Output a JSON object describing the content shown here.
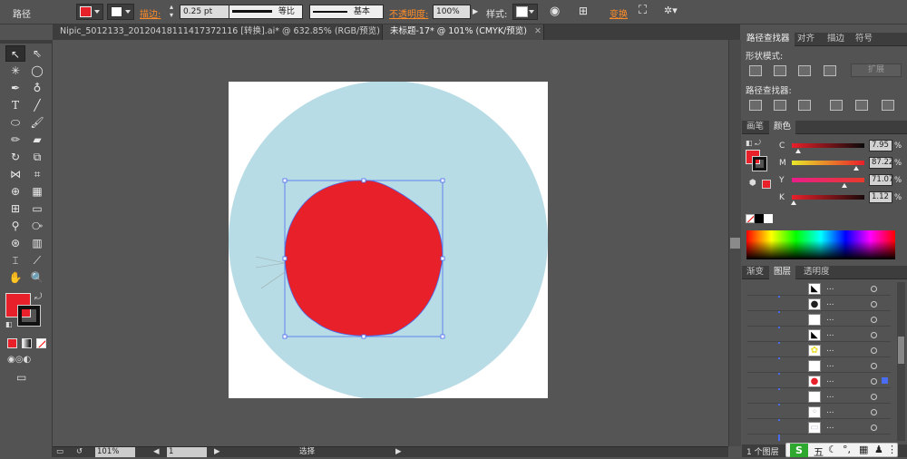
{
  "control_bar": {
    "object_label": "路径",
    "fill_color": "#e8202a",
    "stroke_label": "描边:",
    "stroke_width": "0.25 pt",
    "profile_label": "等比",
    "brush_label": "基本",
    "opacity_label": "不透明度:",
    "opacity_value": "100%",
    "style_label": "样式:",
    "transform_label": "变换"
  },
  "document_tabs": [
    {
      "label": "Nipic_5012133_20120418111417372116 [转换].ai* @ 632.85% (RGB/预览)"
    },
    {
      "label": "未标题-17* @ 101% (CMYK/预览)"
    }
  ],
  "artwork": {
    "circle_color": "#b8dce5",
    "blob_color": "#e8202a",
    "selection_color": "#4a6cf0"
  },
  "status_bar": {
    "zoom": "101%",
    "page": "1",
    "tool": "选择"
  },
  "pathfinder_panel": {
    "tabs": [
      "路径查找器",
      "对齐",
      "描边",
      "符号"
    ],
    "shape_modes_label": "形状模式:",
    "expand_label": "扩展",
    "pathfinders_label": "路径查找器:"
  },
  "color_panel": {
    "tabs": [
      "画笔",
      "颜色"
    ],
    "fill_color": "#e8202a",
    "channels": [
      {
        "label": "C",
        "value": "7.95",
        "unit": "%",
        "level": 0.08
      },
      {
        "label": "M",
        "value": "87.22",
        "unit": "%",
        "level": 0.87
      },
      {
        "label": "Y",
        "value": "71.07",
        "unit": "%",
        "level": 0.71
      },
      {
        "label": "K",
        "value": "1.12",
        "unit": "%",
        "level": 0.01
      }
    ]
  },
  "layers_panel": {
    "tabs": [
      "渐变",
      "图层",
      "透明度"
    ],
    "rows": [
      {
        "dots": "..."
      },
      {
        "dots": "..."
      },
      {
        "dots": "..."
      },
      {
        "dots": "..."
      },
      {
        "dots": "..."
      },
      {
        "dots": "..."
      },
      {
        "dots": "..."
      },
      {
        "dots": "..."
      },
      {
        "dots": "..."
      },
      {
        "dots": "..."
      }
    ],
    "footer": "1 个图层"
  },
  "taskbar": {
    "ime_label": "五"
  }
}
